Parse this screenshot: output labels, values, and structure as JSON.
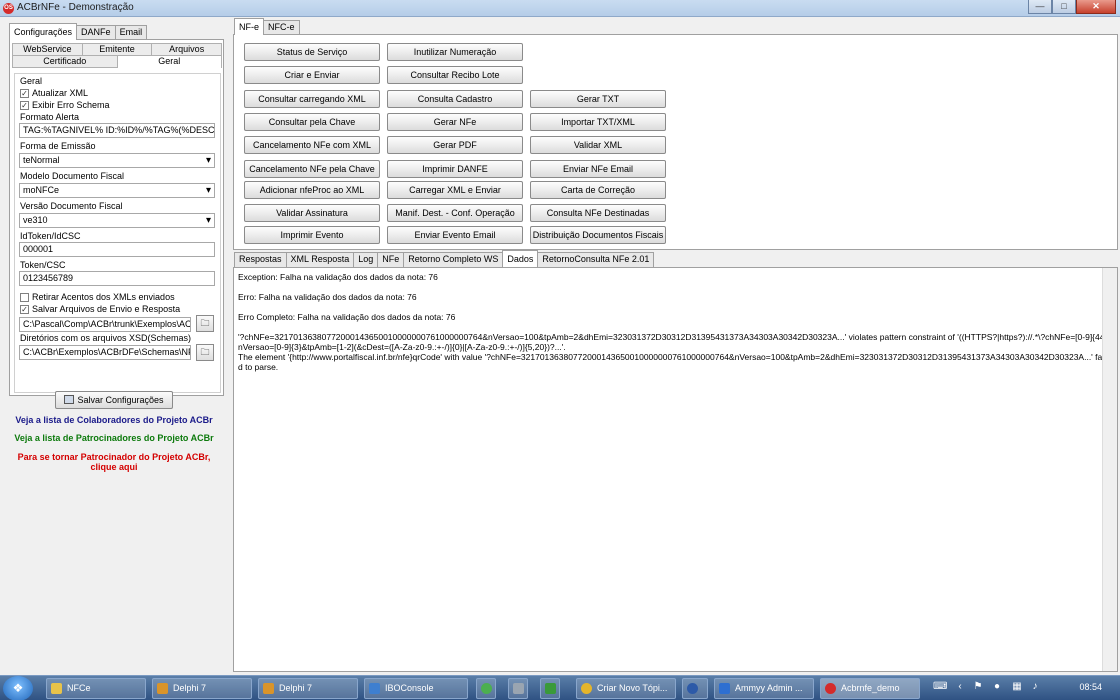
{
  "window": {
    "title": "ACBrNFe - Demonstração",
    "min": "—",
    "max": "□",
    "close": "✕"
  },
  "left": {
    "tabs": [
      "Configurações",
      "DANFe",
      "Email"
    ],
    "subtabs_row1": [
      "WebService",
      "Emitente",
      "Arquivos"
    ],
    "subtabs_row2": [
      "Certificado",
      "Geral"
    ],
    "group_title": "Geral",
    "atualizar_xml": "Atualizar XML",
    "exibir_erro": "Exibir Erro Schema",
    "formato_alerta_label": "Formato Alerta",
    "formato_alerta_value": "TAG:%TAGNIVEL% ID:%ID%/%TAG%(%DESCRICA",
    "forma_emissao_label": "Forma de Emissão",
    "forma_emissao_value": "teNormal",
    "modelo_label": "Modelo Documento Fiscal",
    "modelo_value": "moNFCe",
    "versao_label": "Versão Documento Fiscal",
    "versao_value": "ve310",
    "idtoken_label": "IdToken/IdCSC",
    "idtoken_value": "000001",
    "token_label": "Token/CSC",
    "token_value": "0123456789",
    "retirar_acentos": "Retirar Acentos dos XMLs enviados",
    "salvar_arquivos": "Salvar Arquivos de Envio e Resposta",
    "salvar_path": "C:\\Pascal\\Comp\\ACBr\\trunk\\Exemplos\\ACBrN",
    "schemas_label": "Diretórios com os arquivos XSD(Schemas)",
    "schemas_path": "C:\\ACBr\\Exemplos\\ACBrDFe\\Schemas\\NFe",
    "save_button": "Salvar Configurações",
    "promo_colab": "Veja a lista de Colaboradores do Projeto ACBr",
    "promo_patro": "Veja a lista de Patrocinadores do Projeto ACBr",
    "promo_become_1": "Para se tornar Patrocinador do Projeto ACBr,",
    "promo_become_2": "clique aqui",
    "colors": {
      "colab": "#1b1b8a",
      "patro": "#0d7a0d",
      "become": "#d40000"
    }
  },
  "right": {
    "tabs": [
      "NF-e",
      "NFC-e"
    ],
    "buttons_col1": [
      "Status de Serviço",
      "Criar e Enviar",
      "Consultar carregando XML",
      "Consultar pela Chave",
      "Cancelamento NFe com XML",
      "Cancelamento NFe pela Chave",
      "Adicionar nfeProc ao XML",
      "Validar Assinatura",
      "Imprimir Evento"
    ],
    "buttons_col2": [
      "Inutilizar Numeração",
      "Consultar Recibo Lote",
      "Consulta Cadastro",
      "Gerar NFe",
      "Gerar PDF",
      "Imprimir DANFE",
      "Carregar XML e Enviar",
      "Manif. Dest. - Conf. Operação",
      "Enviar Evento Email"
    ],
    "buttons_col3": [
      "Gerar TXT",
      "Importar TXT/XML",
      "Validar XML",
      "Enviar NFe Email",
      "Carta de Correção",
      "Consulta NFe Destinadas",
      "Distribuição Documentos Fiscais"
    ],
    "bottom_tabs": [
      "Respostas",
      "XML Resposta",
      "Log",
      "NFe",
      "Retorno Completo WS",
      "Dados",
      "RetornoConsulta NFe 2.01"
    ],
    "result": {
      "line1": "Exception: Falha na validação dos dados da nota: 76",
      "line2": "Erro: Falha na validação dos dados da nota: 76",
      "line3": "Erro Completo: Falha na validação dos dados da nota: 76",
      "line4": "'?chNFe=32170136380772000143650010000000761000000764&nVersao=100&tpAmb=2&dhEmi=323031372D30312D31395431373A34303A30342D30323A...' violates pattern constraint of '((HTTPS?|https?)://.*\\?chNFe=[0-9]{44}&nVersao=[0-9]{3}&tpAmb=[1-2](&cDest=([A-Za-z0-9.:+-/)]{0}|[A-Za-z0-9.:+-/)]{5,20})?...'.\nThe element '{http://www.portalfiscal.inf.br/nfe}qrCode' with value '?chNFe=32170136380772000143650010000000761000000764&nVersao=100&tpAmb=2&dhEmi=323031372D30312D31395431373A34303A30342D30323A...' failed to parse."
    }
  },
  "taskbar": {
    "start_icon": "❖",
    "items": [
      "NFCe",
      "Delphi 7",
      "Delphi 7",
      "IBOConsole",
      "Criar Novo Tópi...",
      "Ammyy Admin ...",
      "Acbrnfe_demo"
    ],
    "clock": "08:54"
  }
}
